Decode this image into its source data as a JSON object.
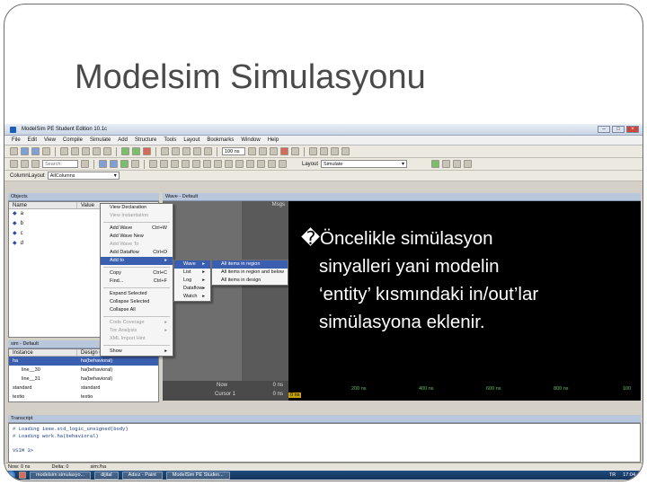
{
  "slide": {
    "title": "Modelsim Simulasyonu",
    "bullet_marker": "�",
    "bullet_lines": [
      "Öncelikle simülasyon",
      "sinyalleri yani modelin",
      "‘entity’ kısmındaki in/out’lar",
      "simülasyona eklenir."
    ]
  },
  "app": {
    "window_title": "ModelSim PE Student Edition 10.1c",
    "menu": [
      "File",
      "Edit",
      "View",
      "Compile",
      "Simulate",
      "Add",
      "Structure",
      "Tools",
      "Layout",
      "Bookmarks",
      "Window",
      "Help"
    ],
    "toolbar": {
      "search_placeholder": "Search:",
      "run_length": "100 ns",
      "layout_label": "Layout",
      "layout_value": "Simulate",
      "column_layout_label": "ColumnLayout",
      "column_layout_value": "AllColumns"
    }
  },
  "objects_pane": {
    "title": "Objects",
    "columns": [
      "Name",
      "Value"
    ],
    "rows": [
      {
        "name": "a",
        "value": ""
      },
      {
        "name": "b",
        "value": ""
      },
      {
        "name": "c",
        "value": ""
      },
      {
        "name": "d",
        "value": ""
      }
    ]
  },
  "context_menu": {
    "items": [
      {
        "label": "View Declaration",
        "shortcut": "",
        "disabled": false
      },
      {
        "label": "View Instantiation",
        "shortcut": "",
        "disabled": true
      },
      {
        "sep": true
      },
      {
        "label": "Add Wave",
        "shortcut": "Ctrl+W",
        "disabled": false
      },
      {
        "label": "Add Wave New",
        "shortcut": "",
        "disabled": false
      },
      {
        "label": "Add Wave To",
        "shortcut": "",
        "disabled": true
      },
      {
        "label": "Add Dataflow",
        "shortcut": "Ctrl+D",
        "disabled": false
      },
      {
        "label": "Add to",
        "shortcut": "▸",
        "disabled": false,
        "highlighted": true
      },
      {
        "sep": true
      },
      {
        "label": "Copy",
        "shortcut": "Ctrl+C",
        "disabled": false
      },
      {
        "label": "Find...",
        "shortcut": "Ctrl+F",
        "disabled": false
      },
      {
        "sep": true
      },
      {
        "label": "Expand Selected",
        "shortcut": "",
        "disabled": false
      },
      {
        "label": "Collapse Selected",
        "shortcut": "",
        "disabled": false
      },
      {
        "label": "Collapse All",
        "shortcut": "",
        "disabled": false
      },
      {
        "sep": true
      },
      {
        "label": "Code Coverage",
        "shortcut": "▸",
        "disabled": true
      },
      {
        "label": "Toc Analysis",
        "shortcut": "▸",
        "disabled": true
      },
      {
        "label": "XML Import Hint",
        "shortcut": "",
        "disabled": true
      },
      {
        "sep": true
      },
      {
        "label": "Show",
        "shortcut": "▸",
        "disabled": false
      }
    ],
    "submenu1": [
      {
        "label": "Wave",
        "highlighted": true
      },
      {
        "label": "List"
      },
      {
        "label": "Log"
      },
      {
        "label": "Dataflow"
      },
      {
        "label": "Watch"
      }
    ],
    "submenu2": [
      {
        "label": "All items in region",
        "highlighted": true
      },
      {
        "label": "All items in region and below"
      },
      {
        "label": "All items in design"
      }
    ]
  },
  "wave_pane": {
    "title": "Wave - Default",
    "msgs_label": "Msgs",
    "now_label": "Now",
    "now_value": "0 ns",
    "cursor_label": "Cursor 1",
    "cursor_value": "0 ns",
    "cursor_tag": "0 ns",
    "ruler_ticks": [
      "200 ns",
      "400 ns",
      "600 ns",
      "800 ns",
      "100"
    ]
  },
  "instance_pane": {
    "title": "sim - Default",
    "columns": [
      "Instance",
      "Design unit"
    ],
    "rows": [
      {
        "instance": "ha",
        "unit": "ha(behavioral)",
        "selected": true
      },
      {
        "instance": "line__30",
        "unit": "ha(behavioral)",
        "selected": false
      },
      {
        "instance": "line__31",
        "unit": "ha(behavioral)",
        "selected": false
      },
      {
        "instance": "standard",
        "unit": "standard",
        "selected": false
      },
      {
        "instance": "textio",
        "unit": "textio",
        "selected": false
      },
      {
        "instance": "std_logic_1164",
        "unit": "std_logic_1164",
        "selected": false
      }
    ]
  },
  "transcript": {
    "title": "Transcript",
    "lines": [
      "# Loading ieee.std_logic_unsigned(body)",
      "# Loading work.ha(behavioral)",
      "",
      "VSIM 3>"
    ]
  },
  "status": {
    "now": "Now: 0 ns",
    "delta": "Delta: 0",
    "path": "sim:/ha"
  },
  "taskbar": {
    "buttons": [
      "modelsim simulasyo...",
      "dijital",
      "Adsız - Paint",
      "ModelSim PE Studen..."
    ],
    "lang": "TR",
    "clock": "17:04"
  }
}
